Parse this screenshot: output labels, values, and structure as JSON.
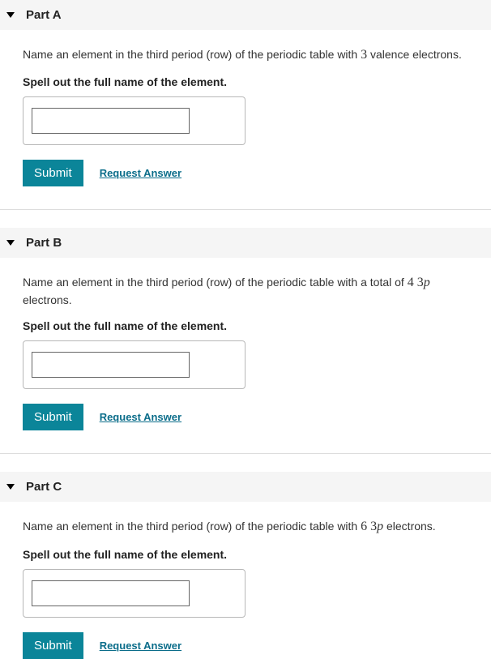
{
  "parts": [
    {
      "title": "Part A",
      "question_pre": "Name an element in the third period (row) of the periodic table with ",
      "math_num": "3",
      "math_var": "",
      "question_post": " valence electrons.",
      "instruction": "Spell out the full name of the element.",
      "input_value": "",
      "submit_label": "Submit",
      "request_label": "Request Answer"
    },
    {
      "title": "Part B",
      "question_pre": "Name an element in the third period (row) of the periodic table with a total of ",
      "math_num": "4 3",
      "math_var": "p",
      "question_post": " electrons.",
      "instruction": "Spell out the full name of the element.",
      "input_value": "",
      "submit_label": "Submit",
      "request_label": "Request Answer"
    },
    {
      "title": "Part C",
      "question_pre": "Name an element in the third period (row) of the periodic table with ",
      "math_num": "6 3",
      "math_var": "p",
      "question_post": " electrons.",
      "instruction": "Spell out the full name of the element.",
      "input_value": "",
      "submit_label": "Submit",
      "request_label": "Request Answer"
    }
  ]
}
